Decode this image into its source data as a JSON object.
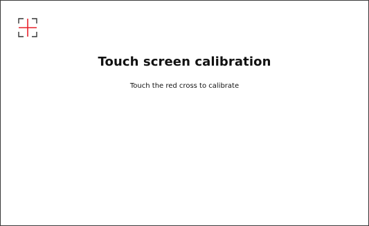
{
  "calibration": {
    "title": "Touch screen calibration",
    "instruction": "Touch the red cross to calibrate",
    "target_icon": "crosshair-target-icon",
    "cross_color": "#e8202a",
    "bracket_color": "#333333"
  }
}
